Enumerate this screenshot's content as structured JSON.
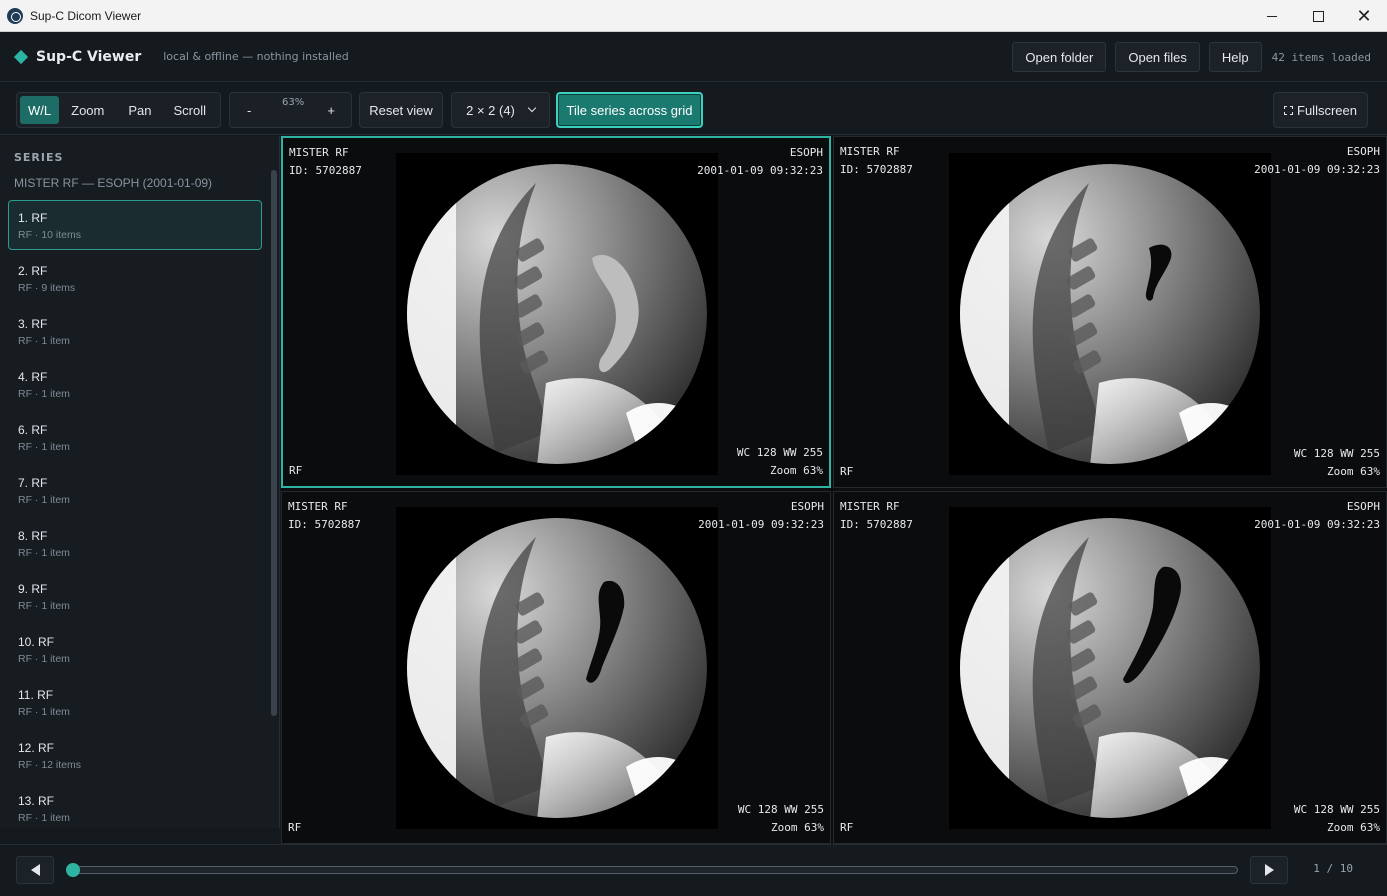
{
  "window": {
    "title": "Sup-C Dicom Viewer",
    "minimize_icon": "minimize-icon",
    "maximize_icon": "maximize-icon",
    "close_icon": "close-icon"
  },
  "header": {
    "brand": "Sup-C Viewer",
    "tagline": "local & offline — nothing installed",
    "open_folder": "Open folder",
    "open_files": "Open files",
    "help": "Help",
    "items_loaded": "42 items loaded"
  },
  "toolbar": {
    "tools": [
      "W/L",
      "Zoom",
      "Pan",
      "Scroll"
    ],
    "active_tool": "W/L",
    "zoom_minus": "-",
    "zoom_value": "63%",
    "zoom_plus": "+",
    "reset_view": "Reset view",
    "layout_select": "2 × 2 (4)",
    "tile_series": "Tile series across grid",
    "fullscreen": "Fullscreen",
    "colors": {
      "accent": "#2fb3a3",
      "active_tool_bg": "#1d6d66",
      "tile_bg": "#1a7a70"
    }
  },
  "sidebar": {
    "title": "SERIES",
    "study": "MISTER RF — ESOPH (2001-01-09)",
    "series": [
      {
        "name": "1. RF",
        "meta": "RF · 10 items",
        "active": true
      },
      {
        "name": "2. RF",
        "meta": "RF · 9 items"
      },
      {
        "name": "3. RF",
        "meta": "RF · 1 item"
      },
      {
        "name": "4. RF",
        "meta": "RF · 1 item"
      },
      {
        "name": "6. RF",
        "meta": "RF · 1 item"
      },
      {
        "name": "7. RF",
        "meta": "RF · 1 item"
      },
      {
        "name": "8. RF",
        "meta": "RF · 1 item"
      },
      {
        "name": "9. RF",
        "meta": "RF · 1 item"
      },
      {
        "name": "10. RF",
        "meta": "RF · 1 item"
      },
      {
        "name": "11. RF",
        "meta": "RF · 1 item"
      },
      {
        "name": "12. RF",
        "meta": "RF · 12 items"
      },
      {
        "name": "13. RF",
        "meta": "RF · 1 item"
      }
    ]
  },
  "viewports": [
    {
      "patient": "MISTER RF",
      "id": "ID: 5702887",
      "study": "ESOPH",
      "datetime": "2001-01-09 09:32:23",
      "wl": "WC 128 WW 255",
      "zoom": "Zoom 63%",
      "modality": "RF",
      "active": true,
      "contrast": "light"
    },
    {
      "patient": "MISTER RF",
      "id": "ID: 5702887",
      "study": "ESOPH",
      "datetime": "2001-01-09 09:32:23",
      "wl": "WC 128 WW 255",
      "zoom": "Zoom 63%",
      "modality": "RF",
      "contrast": "small"
    },
    {
      "patient": "MISTER RF",
      "id": "ID: 5702887",
      "study": "ESOPH",
      "datetime": "2001-01-09 09:32:23",
      "wl": "WC 128 WW 255",
      "zoom": "Zoom 63%",
      "modality": "RF",
      "contrast": "medium"
    },
    {
      "patient": "MISTER RF",
      "id": "ID: 5702887",
      "study": "ESOPH",
      "datetime": "2001-01-09 09:32:23",
      "wl": "WC 128 WW 255",
      "zoom": "Zoom 63%",
      "modality": "RF",
      "contrast": "large"
    }
  ],
  "footer": {
    "prev_icon": "prev-frame-icon",
    "next_icon": "next-frame-icon",
    "frame_progress": 0.0,
    "frame_counter": "1 / 10"
  }
}
